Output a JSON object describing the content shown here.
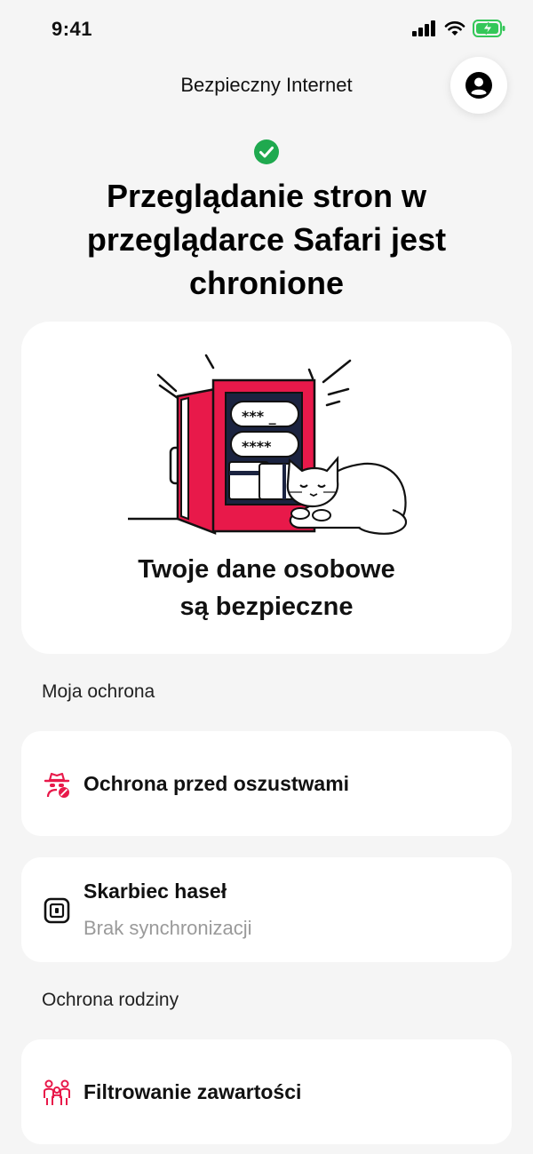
{
  "status_bar": {
    "time": "9:41",
    "icons": [
      "signal-icon",
      "wifi-icon",
      "battery-charging-icon"
    ]
  },
  "header": {
    "title": "Bezpieczny Internet",
    "profile_icon": "user-circle-icon"
  },
  "status": {
    "icon": "check-circle-icon",
    "title": "Przeglądanie stron w przeglądarce Safari jest chronione"
  },
  "hero": {
    "illustration": "open-safe-with-cat-illustration",
    "caption_line1": "Twoje dane osobowe",
    "caption_line2": "są bezpieczne"
  },
  "sections": {
    "my_protection": {
      "title": "Moja ochrona",
      "items": [
        {
          "icon": "fraud-spy-icon",
          "title": "Ochrona przed oszustwami"
        },
        {
          "icon": "password-vault-icon",
          "title": "Skarbiec haseł",
          "subtitle": "Brak synchronizacji"
        }
      ]
    },
    "family_protection": {
      "title": "Ochrona rodziny",
      "items": [
        {
          "icon": "family-filter-icon",
          "title": "Filtrowanie zawartości"
        }
      ]
    }
  },
  "colors": {
    "background": "#f5f5f5",
    "card": "#ffffff",
    "accent_red": "#e8194a",
    "success_green": "#1fa94f",
    "battery_green": "#34c759"
  }
}
